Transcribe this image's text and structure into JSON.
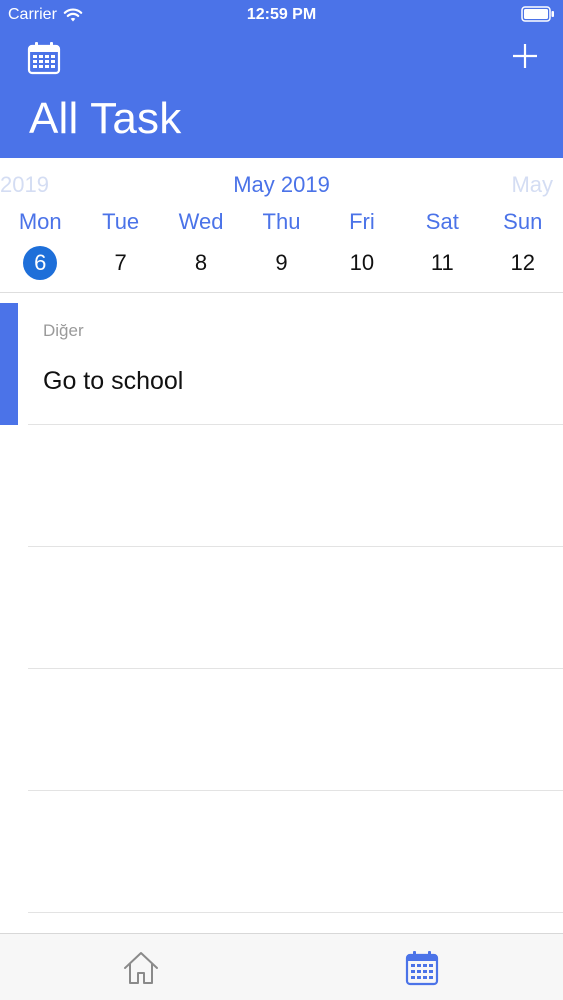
{
  "status_bar": {
    "carrier": "Carrier",
    "time": "12:59 PM"
  },
  "header": {
    "title": "All Task",
    "left_icon": "calendar-icon",
    "right_icon": "plus-icon",
    "background": "#4b73e8"
  },
  "week": {
    "prev_month": "2019",
    "current_month": "May 2019",
    "next_month": "May",
    "days": [
      {
        "name": "Mon",
        "date": "6",
        "selected": true
      },
      {
        "name": "Tue",
        "date": "7"
      },
      {
        "name": "Wed",
        "date": "8"
      },
      {
        "name": "Thu",
        "date": "9"
      },
      {
        "name": "Fri",
        "date": "10"
      },
      {
        "name": "Sat",
        "date": "11"
      },
      {
        "name": "Sun",
        "date": "12"
      }
    ]
  },
  "tasks": [
    {
      "category": "Diğer",
      "title": "Go to school",
      "accent": "#4b73e8"
    }
  ],
  "tab_bar": {
    "items": [
      {
        "icon": "home-icon",
        "active": false
      },
      {
        "icon": "calendar-icon",
        "active": true
      }
    ],
    "active_color": "#4b73e8",
    "inactive_color": "#8a8a8a"
  }
}
